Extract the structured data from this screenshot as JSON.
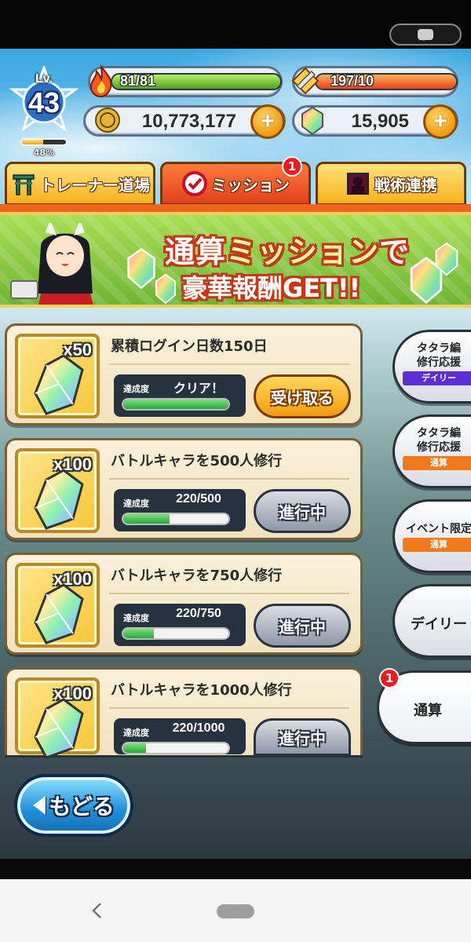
{
  "header": {
    "level_label": "Lv.",
    "level": "43",
    "level_progress_pct": "48%",
    "level_progress": 0.48,
    "stamina": "81/81",
    "stamina_fill": 1.0,
    "battle_points": "197/10",
    "battle_fill": 1.0,
    "gold": "10,773,177",
    "gems": "15,905",
    "plus_symbol": "+"
  },
  "tabs": [
    {
      "label": "トレーナー道場",
      "icon": "dojo-gate-icon",
      "active": false
    },
    {
      "label": "ミッション",
      "icon": "mission-check-icon",
      "active": true,
      "badge": "1"
    },
    {
      "label": "戦術連携",
      "icon": "tactics-icon",
      "active": false
    }
  ],
  "banner": {
    "line1_a": "通算",
    "line1_b": "ミッション",
    "line1_c": "で",
    "line2": "豪華報酬GET!!"
  },
  "missions": [
    {
      "qty": "x50",
      "title": "累積ログイン日数150日",
      "label": "達成度",
      "progress_text": "クリア！",
      "progress": 1.0,
      "button": "受け取る",
      "state": "claim"
    },
    {
      "qty": "x100",
      "title": "バトルキャラを500人修行",
      "label": "達成度",
      "progress_text": "220/500",
      "progress": 0.44,
      "button": "進行中",
      "state": "progress"
    },
    {
      "qty": "x100",
      "title": "バトルキャラを750人修行",
      "label": "達成度",
      "progress_text": "220/750",
      "progress": 0.293,
      "button": "進行中",
      "state": "progress"
    },
    {
      "qty": "x100",
      "title": "バトルキャラを1000人修行",
      "label": "達成度",
      "progress_text": "220/1000",
      "progress": 0.22,
      "button": "進行中",
      "state": "progress"
    }
  ],
  "side_tabs": [
    {
      "line1": "タタラ編",
      "line2": "修行応援",
      "tag": "デイリー",
      "tag_color": "#5a2fd6"
    },
    {
      "line1": "タタラ編",
      "line2": "修行応援",
      "tag": "通算",
      "tag_color": "#f07a1c"
    },
    {
      "line1": "イベント限定",
      "tag": "通算",
      "tag_color": "#f07a1c"
    },
    {
      "line1": "デイリー"
    },
    {
      "line1": "通算",
      "badge": "1"
    }
  ],
  "back_label": "もどる",
  "colors": {
    "stamina_fill": "#6cc23a",
    "battle_fill": "#f0641f",
    "accent_orange": "#f0641f"
  }
}
